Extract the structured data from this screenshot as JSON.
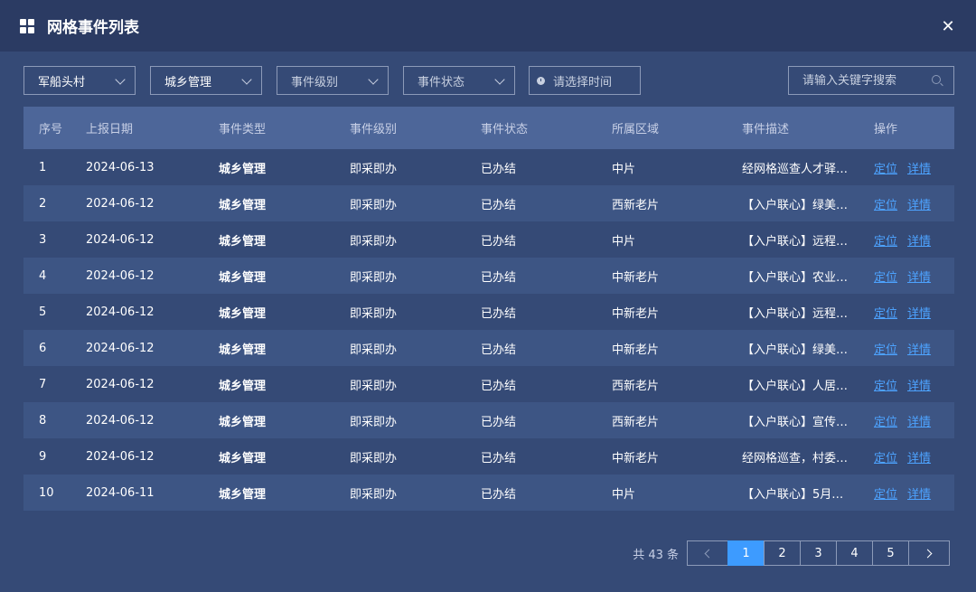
{
  "window": {
    "title": "网格事件列表"
  },
  "filters": {
    "village": "军船头村",
    "event_type": "城乡管理",
    "event_level_placeholder": "事件级别",
    "event_status_placeholder": "事件状态",
    "date_placeholder": "请选择时间",
    "search_placeholder": "请输入关键字搜索"
  },
  "table": {
    "headers": [
      "序号",
      "上报日期",
      "事件类型",
      "事件级别",
      "事件状态",
      "所属区域",
      "事件描述",
      "操作"
    ],
    "rows": [
      {
        "no": "1",
        "date": "2024-06-13",
        "type": "城乡管理",
        "level": "即采即办",
        "status": "已办结",
        "area": "中片",
        "desc": "经网格巡查人才驿…"
      },
      {
        "no": "2",
        "date": "2024-06-12",
        "type": "城乡管理",
        "level": "即采即办",
        "status": "已办结",
        "area": "西新老片",
        "desc": "【入户联心】绿美…"
      },
      {
        "no": "3",
        "date": "2024-06-12",
        "type": "城乡管理",
        "level": "即采即办",
        "status": "已办结",
        "area": "中片",
        "desc": "【入户联心】远程…"
      },
      {
        "no": "4",
        "date": "2024-06-12",
        "type": "城乡管理",
        "level": "即采即办",
        "status": "已办结",
        "area": "中新老片",
        "desc": "【入户联心】农业…"
      },
      {
        "no": "5",
        "date": "2024-06-12",
        "type": "城乡管理",
        "level": "即采即办",
        "status": "已办结",
        "area": "中新老片",
        "desc": "【入户联心】远程…"
      },
      {
        "no": "6",
        "date": "2024-06-12",
        "type": "城乡管理",
        "level": "即采即办",
        "status": "已办结",
        "area": "中新老片",
        "desc": "【入户联心】绿美…"
      },
      {
        "no": "7",
        "date": "2024-06-12",
        "type": "城乡管理",
        "level": "即采即办",
        "status": "已办结",
        "area": "西新老片",
        "desc": "【入户联心】人居…"
      },
      {
        "no": "8",
        "date": "2024-06-12",
        "type": "城乡管理",
        "level": "即采即办",
        "status": "已办结",
        "area": "西新老片",
        "desc": "【入户联心】宣传…"
      },
      {
        "no": "9",
        "date": "2024-06-12",
        "type": "城乡管理",
        "level": "即采即办",
        "status": "已办结",
        "area": "中新老片",
        "desc": "经网格巡查，村委…"
      },
      {
        "no": "10",
        "date": "2024-06-11",
        "type": "城乡管理",
        "level": "即采即办",
        "status": "已办结",
        "area": "中片",
        "desc": "【入户联心】5月…"
      }
    ],
    "action_locate": "定位",
    "action_detail": "详情"
  },
  "pagination": {
    "total_text": "共 43 条",
    "pages": [
      "1",
      "2",
      "3",
      "4",
      "5"
    ],
    "current": "1"
  },
  "colors": {
    "background": "#354a76",
    "titlebar": "#2b3b63",
    "header_row": "#4d6699",
    "link": "#4da3ff",
    "active_page": "#3d9bff"
  }
}
